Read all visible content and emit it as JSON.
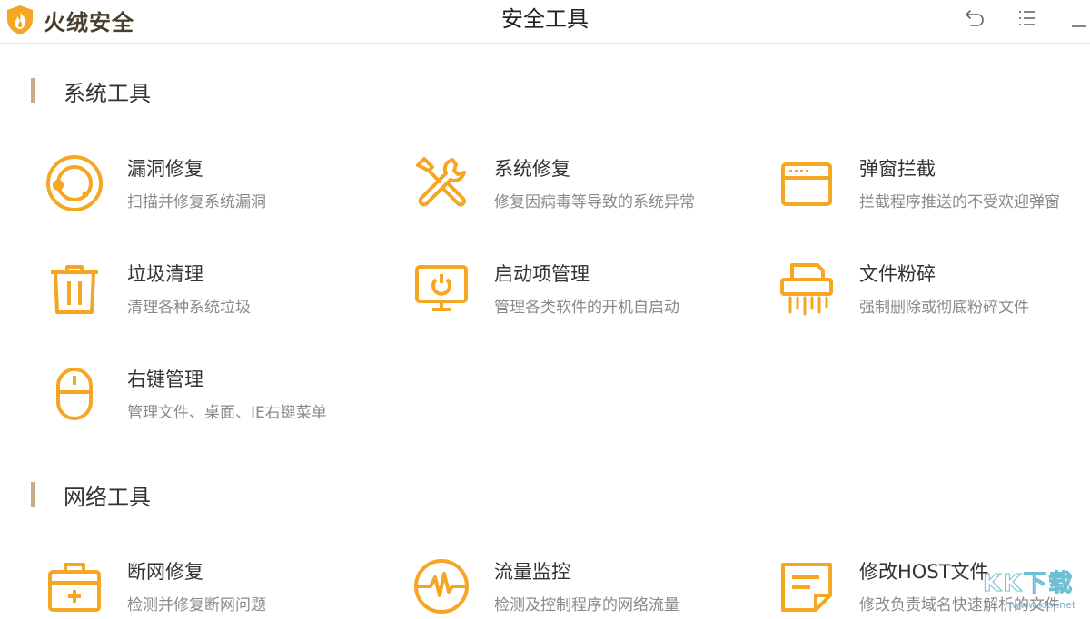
{
  "app": {
    "brand_name": "火绒安全",
    "window_title": "安全工具"
  },
  "colors": {
    "accent": "#f5a623",
    "section_bar": "#c8ab87",
    "text_primary": "#333333",
    "text_secondary": "#8a8a8a"
  },
  "sections": [
    {
      "title": "系统工具",
      "tools": [
        {
          "name": "漏洞修复",
          "desc": "扫描并修复系统漏洞",
          "icon": "vulnerability-repair-icon"
        },
        {
          "name": "系统修复",
          "desc": "修复因病毒等导致的系统异常",
          "icon": "system-repair-tools-icon"
        },
        {
          "name": "弹窗拦截",
          "desc": "拦截程序推送的不受欢迎弹窗",
          "icon": "popup-window-icon"
        },
        {
          "name": "垃圾清理",
          "desc": "清理各种系统垃圾",
          "icon": "trash-can-icon"
        },
        {
          "name": "启动项管理",
          "desc": "管理各类软件的开机自启动",
          "icon": "monitor-power-icon"
        },
        {
          "name": "文件粉碎",
          "desc": "强制删除或彻底粉碎文件",
          "icon": "shredder-icon"
        },
        {
          "name": "右键管理",
          "desc": "管理文件、桌面、IE右键菜单",
          "icon": "mouse-icon"
        }
      ]
    },
    {
      "title": "网络工具",
      "tools": [
        {
          "name": "断网修复",
          "desc": "检测并修复断网问题",
          "icon": "first-aid-kit-icon"
        },
        {
          "name": "流量监控",
          "desc": "检测及控制程序的网络流量",
          "icon": "traffic-gauge-icon"
        },
        {
          "name": "修改HOST文件",
          "desc": "修改负责域名快速解析的文件",
          "icon": "note-document-icon"
        }
      ]
    }
  ],
  "watermark": {
    "text": "KK下载",
    "url": "www.kkx.net"
  }
}
